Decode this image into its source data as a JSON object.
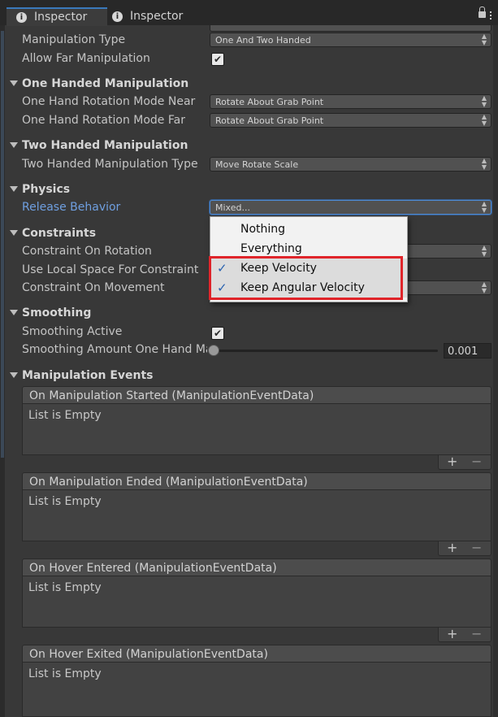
{
  "tabs": [
    {
      "label": "Inspector",
      "active": true
    },
    {
      "label": "Inspector",
      "active": false
    }
  ],
  "fields": {
    "manipulation_type": {
      "label": "Manipulation Type",
      "value": "One And Two Handed"
    },
    "allow_far": {
      "label": "Allow Far Manipulation",
      "checked": true
    }
  },
  "one_handed": {
    "header": "One Handed Manipulation",
    "near": {
      "label": "One Hand Rotation Mode Near",
      "value": "Rotate About Grab Point"
    },
    "far": {
      "label": "One Hand Rotation Mode Far",
      "value": "Rotate About Grab Point"
    }
  },
  "two_handed": {
    "header": "Two Handed Manipulation",
    "type": {
      "label": "Two Handed Manipulation Type",
      "value": "Move Rotate Scale"
    }
  },
  "physics": {
    "header": "Physics",
    "release": {
      "label": "Release Behavior",
      "value": "Mixed..."
    }
  },
  "constraints": {
    "header": "Constraints",
    "rotation_label": "Constraint On Rotation",
    "local_space_label": "Use Local Space For Constraint",
    "movement_label": "Constraint On Movement"
  },
  "smoothing": {
    "header": "Smoothing",
    "active": {
      "label": "Smoothing Active",
      "checked": true
    },
    "amount": {
      "label": "Smoothing Amount One Hand Ma",
      "value": "0.001",
      "slider_fraction": 0.0
    }
  },
  "events": {
    "header": "Manipulation Events",
    "items": [
      {
        "title": "On Manipulation Started (ManipulationEventData)",
        "body": "List is Empty"
      },
      {
        "title": "On Manipulation Ended (ManipulationEventData)",
        "body": "List is Empty"
      },
      {
        "title": "On Hover Entered (ManipulationEventData)",
        "body": "List is Empty"
      },
      {
        "title": "On Hover Exited (ManipulationEventData)",
        "body": "List is Empty"
      }
    ],
    "add_label": "+",
    "remove_label": "−"
  },
  "release_menu": {
    "options": [
      {
        "label": "Nothing",
        "checked": false
      },
      {
        "label": "Everything",
        "checked": false
      },
      {
        "label": "Keep Velocity",
        "checked": true
      },
      {
        "label": "Keep Angular Velocity",
        "checked": true
      }
    ],
    "check_glyph": "✓",
    "highlight_color": "#e0242a"
  },
  "glyphs": {
    "check": "✔",
    "info": "i"
  },
  "colors": {
    "accent": "#3a79bb",
    "link_label": "#6f9fe0",
    "background": "#383838"
  }
}
